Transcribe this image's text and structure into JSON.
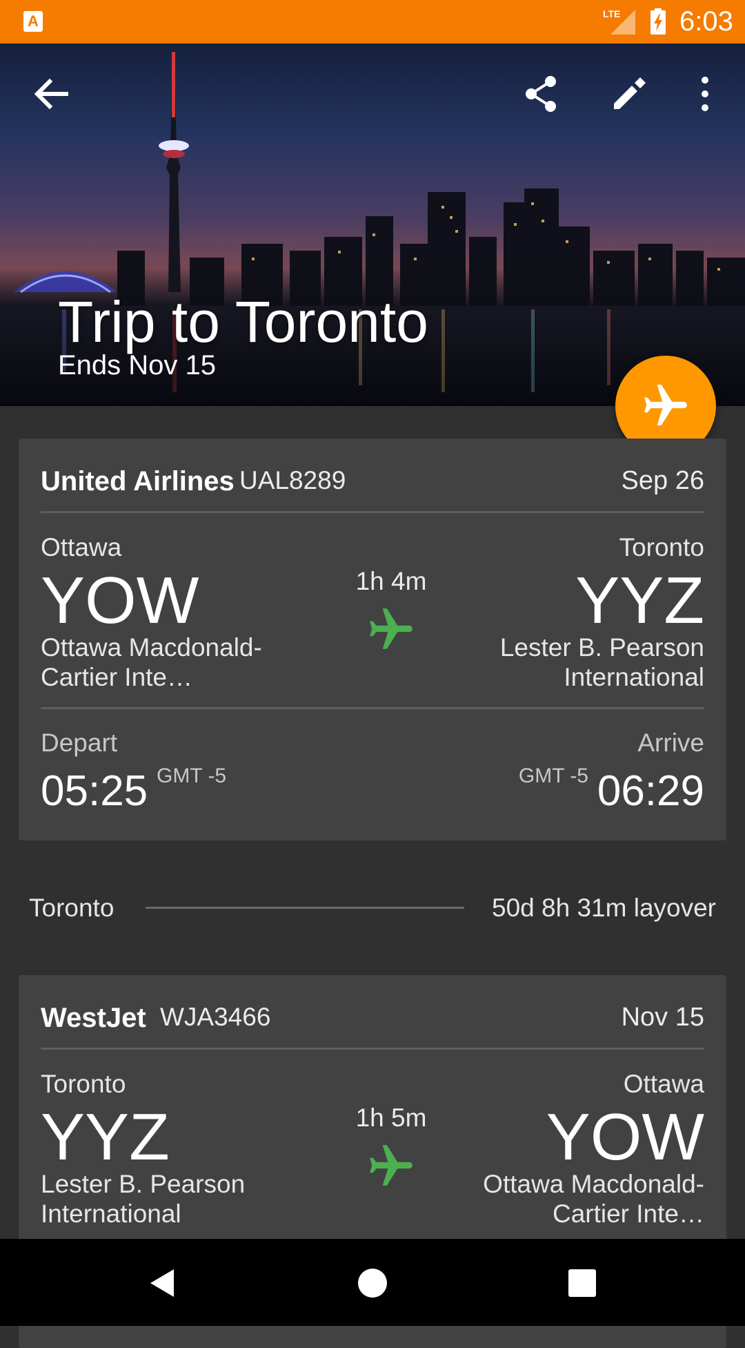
{
  "status_bar": {
    "app_icon_label": "A",
    "network": "LTE",
    "time": "6:03",
    "color": "#f57c00"
  },
  "header": {
    "title": "Trip to Toronto",
    "subtitle": "Ends Nov 15",
    "icons": [
      "back-arrow-icon",
      "share-icon",
      "edit-pencil-icon",
      "more-vert-icon"
    ],
    "fab_icon": "airplane-icon",
    "fab_color": "#ff9800"
  },
  "flights": [
    {
      "airline": "United Airlines",
      "flight_number": "UAL8289",
      "date": "Sep 26",
      "origin_city": "Ottawa",
      "origin_code": "YOW",
      "origin_airport": "Ottawa Macdonald-Cartier Inte…",
      "dest_city": "Toronto",
      "dest_code": "YYZ",
      "dest_airport": "Lester B. Pearson International",
      "duration": "1h 4m",
      "depart_label": "Depart",
      "depart_time": "05:25",
      "depart_tz": "GMT -5",
      "arrive_label": "Arrive",
      "arrive_time": "06:29",
      "arrive_tz": "GMT -5"
    },
    {
      "airline": "WestJet",
      "flight_number": "WJA3466",
      "date": "Nov 15",
      "origin_city": "Toronto",
      "origin_code": "YYZ",
      "origin_airport": "Lester B. Pearson International",
      "dest_city": "Ottawa",
      "dest_code": "YOW",
      "dest_airport": "Ottawa Macdonald-Cartier Inte…",
      "duration": "1h 5m"
    }
  ],
  "layover": {
    "city": "Toronto",
    "duration": "50d 8h 31m layover"
  },
  "plane_icon_color": "#4caf50"
}
